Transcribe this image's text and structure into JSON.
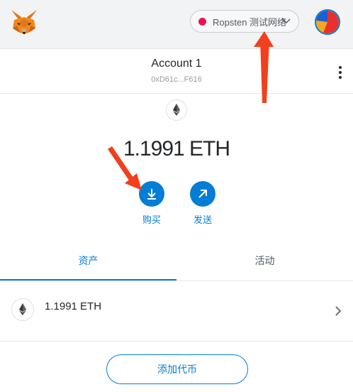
{
  "header": {
    "network_label": "Ropsten 测试网络",
    "network_dot_color": "#e91550"
  },
  "account": {
    "name": "Account 1",
    "address": "0xD61c...F616"
  },
  "balance": {
    "text": "1.1991 ETH"
  },
  "actions": {
    "buy_label": "购买",
    "send_label": "发送"
  },
  "tabs": [
    {
      "label": "资产",
      "active": true
    },
    {
      "label": "活动",
      "active": false
    }
  ],
  "assets": [
    {
      "amount": "1.1991 ETH"
    }
  ],
  "footer": {
    "add_token_label": "添加代币"
  },
  "colors": {
    "accent": "#037dd6",
    "annotation": "#f0401e"
  },
  "icons": [
    "metamask-fox-icon",
    "chevron-down-icon",
    "identicon-avatar",
    "kebab-menu-icon",
    "eth-icon",
    "download-icon",
    "arrow-up-right-icon",
    "chevron-right-icon"
  ]
}
